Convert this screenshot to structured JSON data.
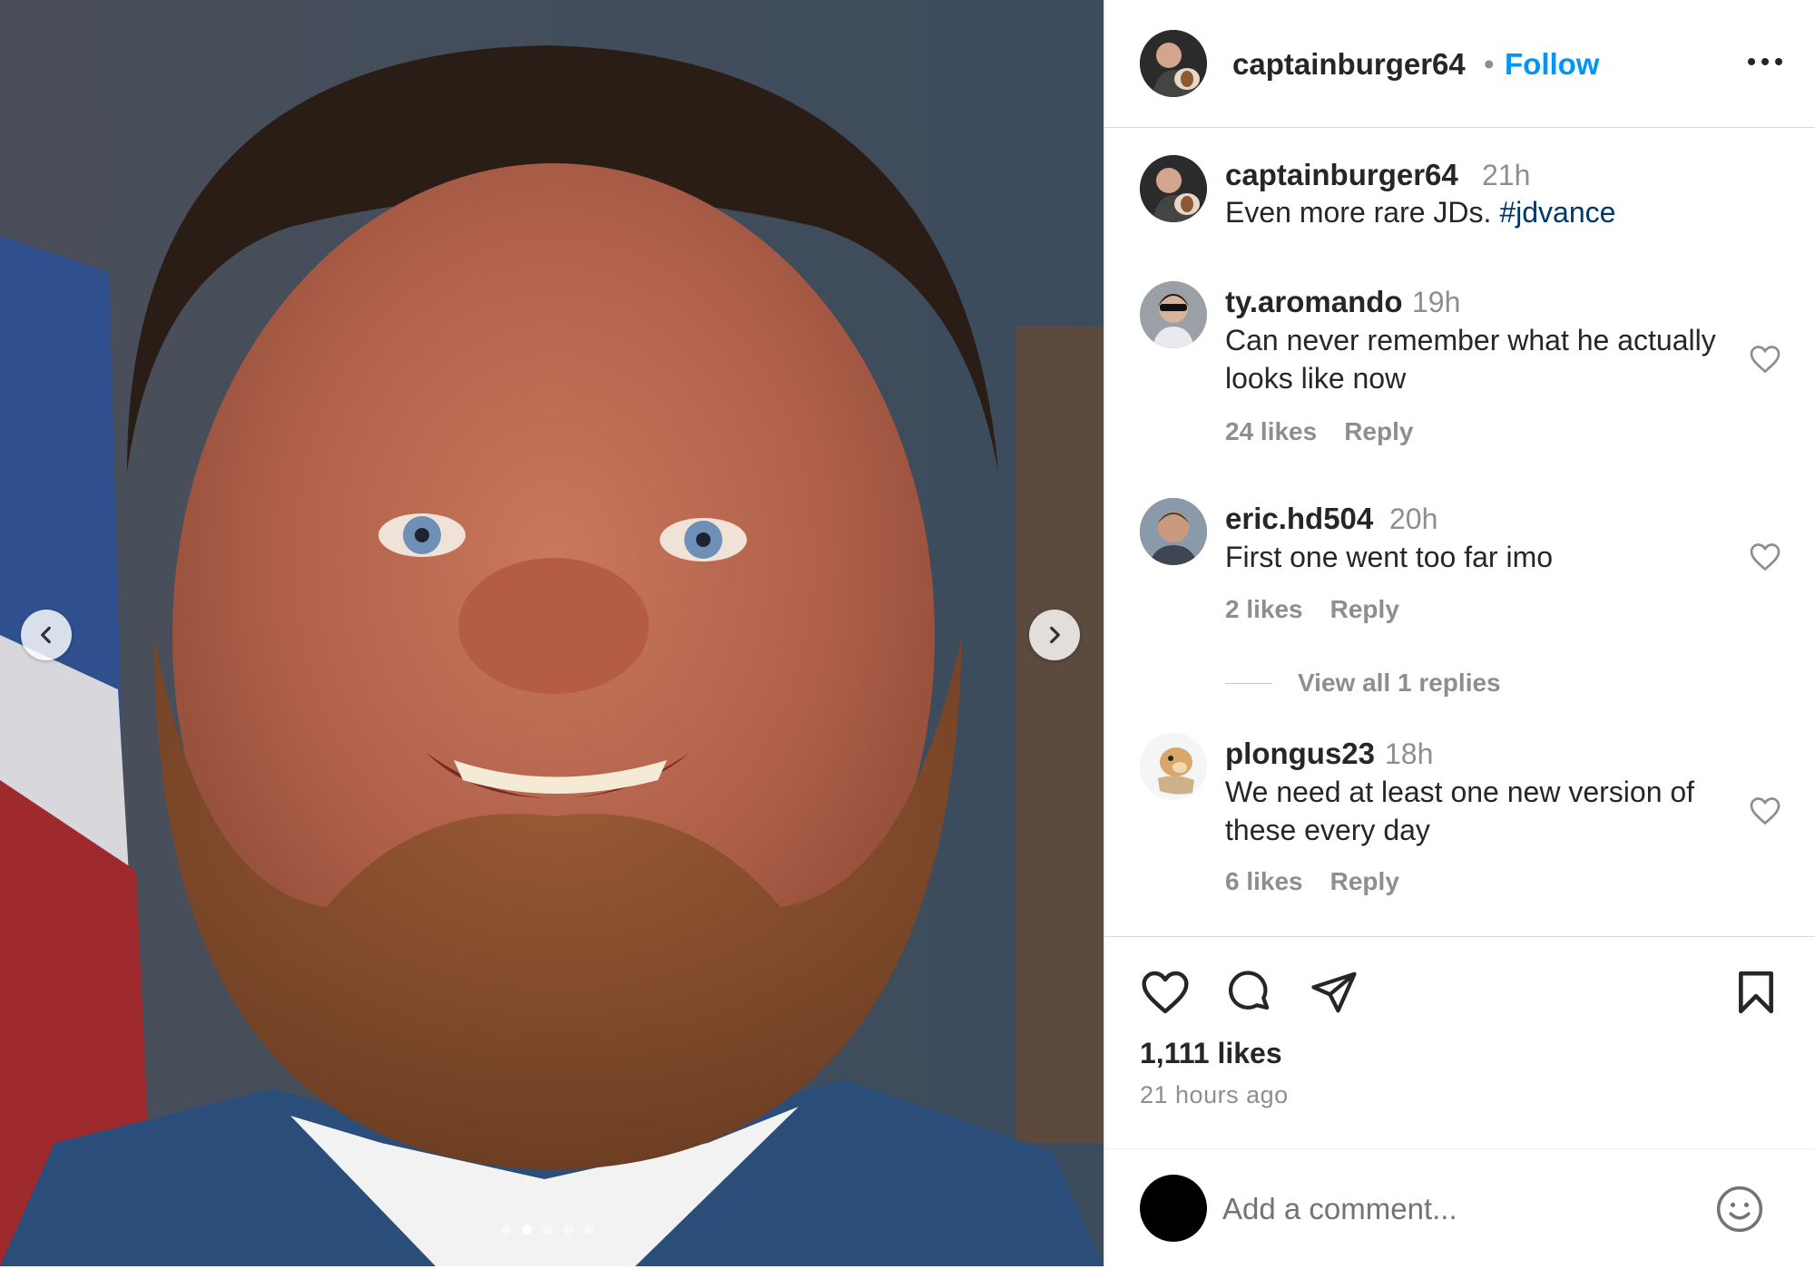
{
  "media": {
    "slides_total": 5,
    "active_slide": 2
  },
  "post": {
    "author": "captainburger64",
    "separator": "•",
    "follow_label": "Follow",
    "caption_time": "21h",
    "caption_text": "Even more rare JDs. ",
    "caption_hashtag": "#jdvance"
  },
  "comments": [
    {
      "user": "ty.aromando",
      "time": "19h",
      "text": "Can never remember what he actually looks like now",
      "likes": "24 likes",
      "reply": "Reply"
    },
    {
      "user": "eric.hd504",
      "time": "20h",
      "text": "First one went too far imo",
      "likes": "2 likes",
      "reply": "Reply",
      "view_replies": "View all 1 replies"
    },
    {
      "user": "plongus23",
      "time": "18h",
      "text": "We need at least one new version of these every day",
      "likes": "6 likes",
      "reply": "Reply"
    }
  ],
  "footer": {
    "likes": "1,111 likes",
    "time_ago": "21 hours ago",
    "comment_placeholder": "Add a comment..."
  },
  "colors": {
    "accent": "#0095f6",
    "hashtag": "#00376b",
    "muted": "#8e8e8e"
  },
  "icons": [
    "chevron-left-icon",
    "chevron-right-icon",
    "more-icon",
    "heart-icon",
    "comment-icon",
    "share-icon",
    "bookmark-icon",
    "emoji-icon"
  ]
}
